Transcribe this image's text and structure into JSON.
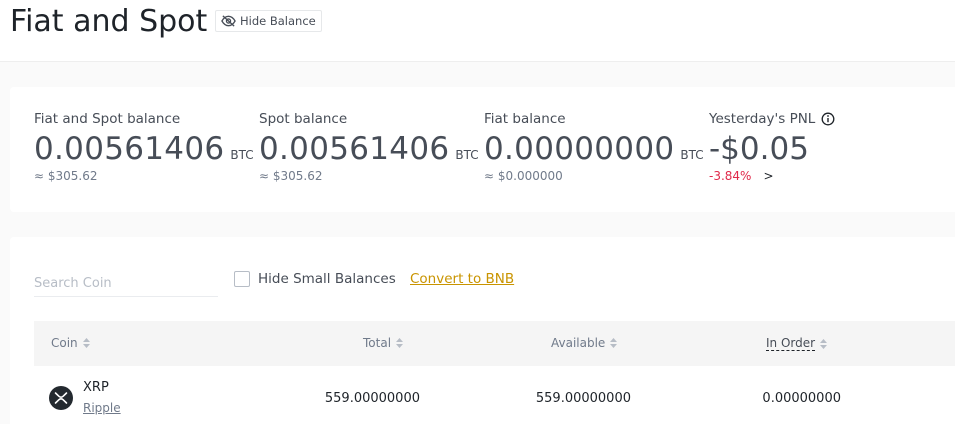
{
  "header": {
    "title": "Fiat and Spot",
    "hide_balance_label": "Hide Balance"
  },
  "balances": {
    "total": {
      "label": "Fiat and Spot balance",
      "value": "0.00561406",
      "unit": "BTC",
      "approx": "≈ $305.62"
    },
    "spot": {
      "label": "Spot balance",
      "value": "0.00561406",
      "unit": "BTC",
      "approx": "≈ $305.62"
    },
    "fiat": {
      "label": "Fiat balance",
      "value": "0.00000000",
      "unit": "BTC",
      "approx": "≈ $0.000000"
    },
    "pnl": {
      "label": "Yesterday's PNL",
      "value": "-$0.05",
      "percent": "-3.84%",
      "arrow": ">"
    }
  },
  "controls": {
    "search_placeholder": "Search Coin",
    "search_value": "",
    "hide_small_label": "Hide Small Balances",
    "hide_small_checked": false,
    "convert_label": "Convert to BNB"
  },
  "table": {
    "columns": [
      "Coin",
      "Total",
      "Available",
      "In Order"
    ],
    "rows": [
      {
        "symbol": "XRP",
        "name": "Ripple",
        "total": "559.00000000",
        "available": "559.00000000",
        "in_order": "0.00000000"
      }
    ]
  },
  "colors": {
    "accent": "#c99400",
    "negative": "#e0294a",
    "text": "#1e2329",
    "muted": "#707a8a"
  },
  "icons": [
    "eye-slash-icon",
    "info-icon",
    "sort-icon",
    "xrp-coin-icon"
  ]
}
